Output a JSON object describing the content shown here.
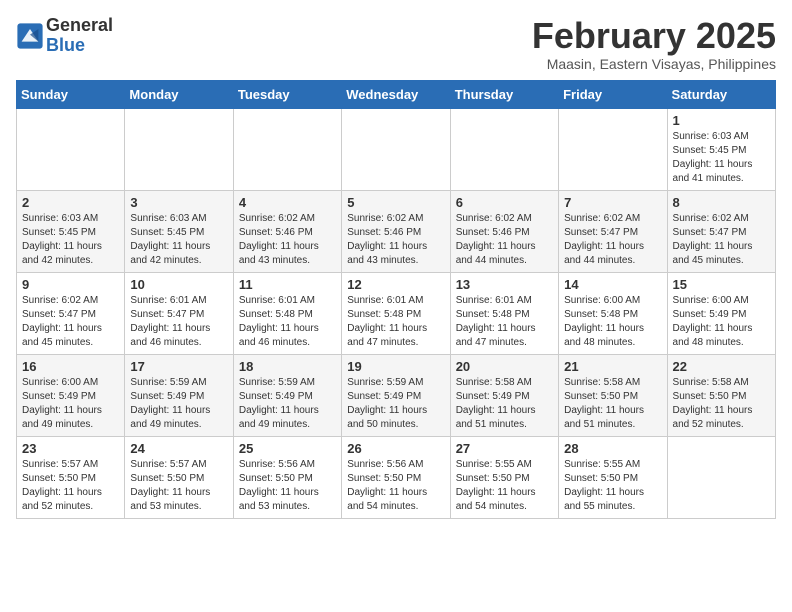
{
  "header": {
    "logo_general": "General",
    "logo_blue": "Blue",
    "month_title": "February 2025",
    "location": "Maasin, Eastern Visayas, Philippines"
  },
  "days_of_week": [
    "Sunday",
    "Monday",
    "Tuesday",
    "Wednesday",
    "Thursday",
    "Friday",
    "Saturday"
  ],
  "weeks": [
    [
      {
        "day": "",
        "info": ""
      },
      {
        "day": "",
        "info": ""
      },
      {
        "day": "",
        "info": ""
      },
      {
        "day": "",
        "info": ""
      },
      {
        "day": "",
        "info": ""
      },
      {
        "day": "",
        "info": ""
      },
      {
        "day": "1",
        "info": "Sunrise: 6:03 AM\nSunset: 5:45 PM\nDaylight: 11 hours\nand 41 minutes."
      }
    ],
    [
      {
        "day": "2",
        "info": "Sunrise: 6:03 AM\nSunset: 5:45 PM\nDaylight: 11 hours\nand 42 minutes."
      },
      {
        "day": "3",
        "info": "Sunrise: 6:03 AM\nSunset: 5:45 PM\nDaylight: 11 hours\nand 42 minutes."
      },
      {
        "day": "4",
        "info": "Sunrise: 6:02 AM\nSunset: 5:46 PM\nDaylight: 11 hours\nand 43 minutes."
      },
      {
        "day": "5",
        "info": "Sunrise: 6:02 AM\nSunset: 5:46 PM\nDaylight: 11 hours\nand 43 minutes."
      },
      {
        "day": "6",
        "info": "Sunrise: 6:02 AM\nSunset: 5:46 PM\nDaylight: 11 hours\nand 44 minutes."
      },
      {
        "day": "7",
        "info": "Sunrise: 6:02 AM\nSunset: 5:47 PM\nDaylight: 11 hours\nand 44 minutes."
      },
      {
        "day": "8",
        "info": "Sunrise: 6:02 AM\nSunset: 5:47 PM\nDaylight: 11 hours\nand 45 minutes."
      }
    ],
    [
      {
        "day": "9",
        "info": "Sunrise: 6:02 AM\nSunset: 5:47 PM\nDaylight: 11 hours\nand 45 minutes."
      },
      {
        "day": "10",
        "info": "Sunrise: 6:01 AM\nSunset: 5:47 PM\nDaylight: 11 hours\nand 46 minutes."
      },
      {
        "day": "11",
        "info": "Sunrise: 6:01 AM\nSunset: 5:48 PM\nDaylight: 11 hours\nand 46 minutes."
      },
      {
        "day": "12",
        "info": "Sunrise: 6:01 AM\nSunset: 5:48 PM\nDaylight: 11 hours\nand 47 minutes."
      },
      {
        "day": "13",
        "info": "Sunrise: 6:01 AM\nSunset: 5:48 PM\nDaylight: 11 hours\nand 47 minutes."
      },
      {
        "day": "14",
        "info": "Sunrise: 6:00 AM\nSunset: 5:48 PM\nDaylight: 11 hours\nand 48 minutes."
      },
      {
        "day": "15",
        "info": "Sunrise: 6:00 AM\nSunset: 5:49 PM\nDaylight: 11 hours\nand 48 minutes."
      }
    ],
    [
      {
        "day": "16",
        "info": "Sunrise: 6:00 AM\nSunset: 5:49 PM\nDaylight: 11 hours\nand 49 minutes."
      },
      {
        "day": "17",
        "info": "Sunrise: 5:59 AM\nSunset: 5:49 PM\nDaylight: 11 hours\nand 49 minutes."
      },
      {
        "day": "18",
        "info": "Sunrise: 5:59 AM\nSunset: 5:49 PM\nDaylight: 11 hours\nand 49 minutes."
      },
      {
        "day": "19",
        "info": "Sunrise: 5:59 AM\nSunset: 5:49 PM\nDaylight: 11 hours\nand 50 minutes."
      },
      {
        "day": "20",
        "info": "Sunrise: 5:58 AM\nSunset: 5:49 PM\nDaylight: 11 hours\nand 51 minutes."
      },
      {
        "day": "21",
        "info": "Sunrise: 5:58 AM\nSunset: 5:50 PM\nDaylight: 11 hours\nand 51 minutes."
      },
      {
        "day": "22",
        "info": "Sunrise: 5:58 AM\nSunset: 5:50 PM\nDaylight: 11 hours\nand 52 minutes."
      }
    ],
    [
      {
        "day": "23",
        "info": "Sunrise: 5:57 AM\nSunset: 5:50 PM\nDaylight: 11 hours\nand 52 minutes."
      },
      {
        "day": "24",
        "info": "Sunrise: 5:57 AM\nSunset: 5:50 PM\nDaylight: 11 hours\nand 53 minutes."
      },
      {
        "day": "25",
        "info": "Sunrise: 5:56 AM\nSunset: 5:50 PM\nDaylight: 11 hours\nand 53 minutes."
      },
      {
        "day": "26",
        "info": "Sunrise: 5:56 AM\nSunset: 5:50 PM\nDaylight: 11 hours\nand 54 minutes."
      },
      {
        "day": "27",
        "info": "Sunrise: 5:55 AM\nSunset: 5:50 PM\nDaylight: 11 hours\nand 54 minutes."
      },
      {
        "day": "28",
        "info": "Sunrise: 5:55 AM\nSunset: 5:50 PM\nDaylight: 11 hours\nand 55 minutes."
      },
      {
        "day": "",
        "info": ""
      }
    ]
  ]
}
